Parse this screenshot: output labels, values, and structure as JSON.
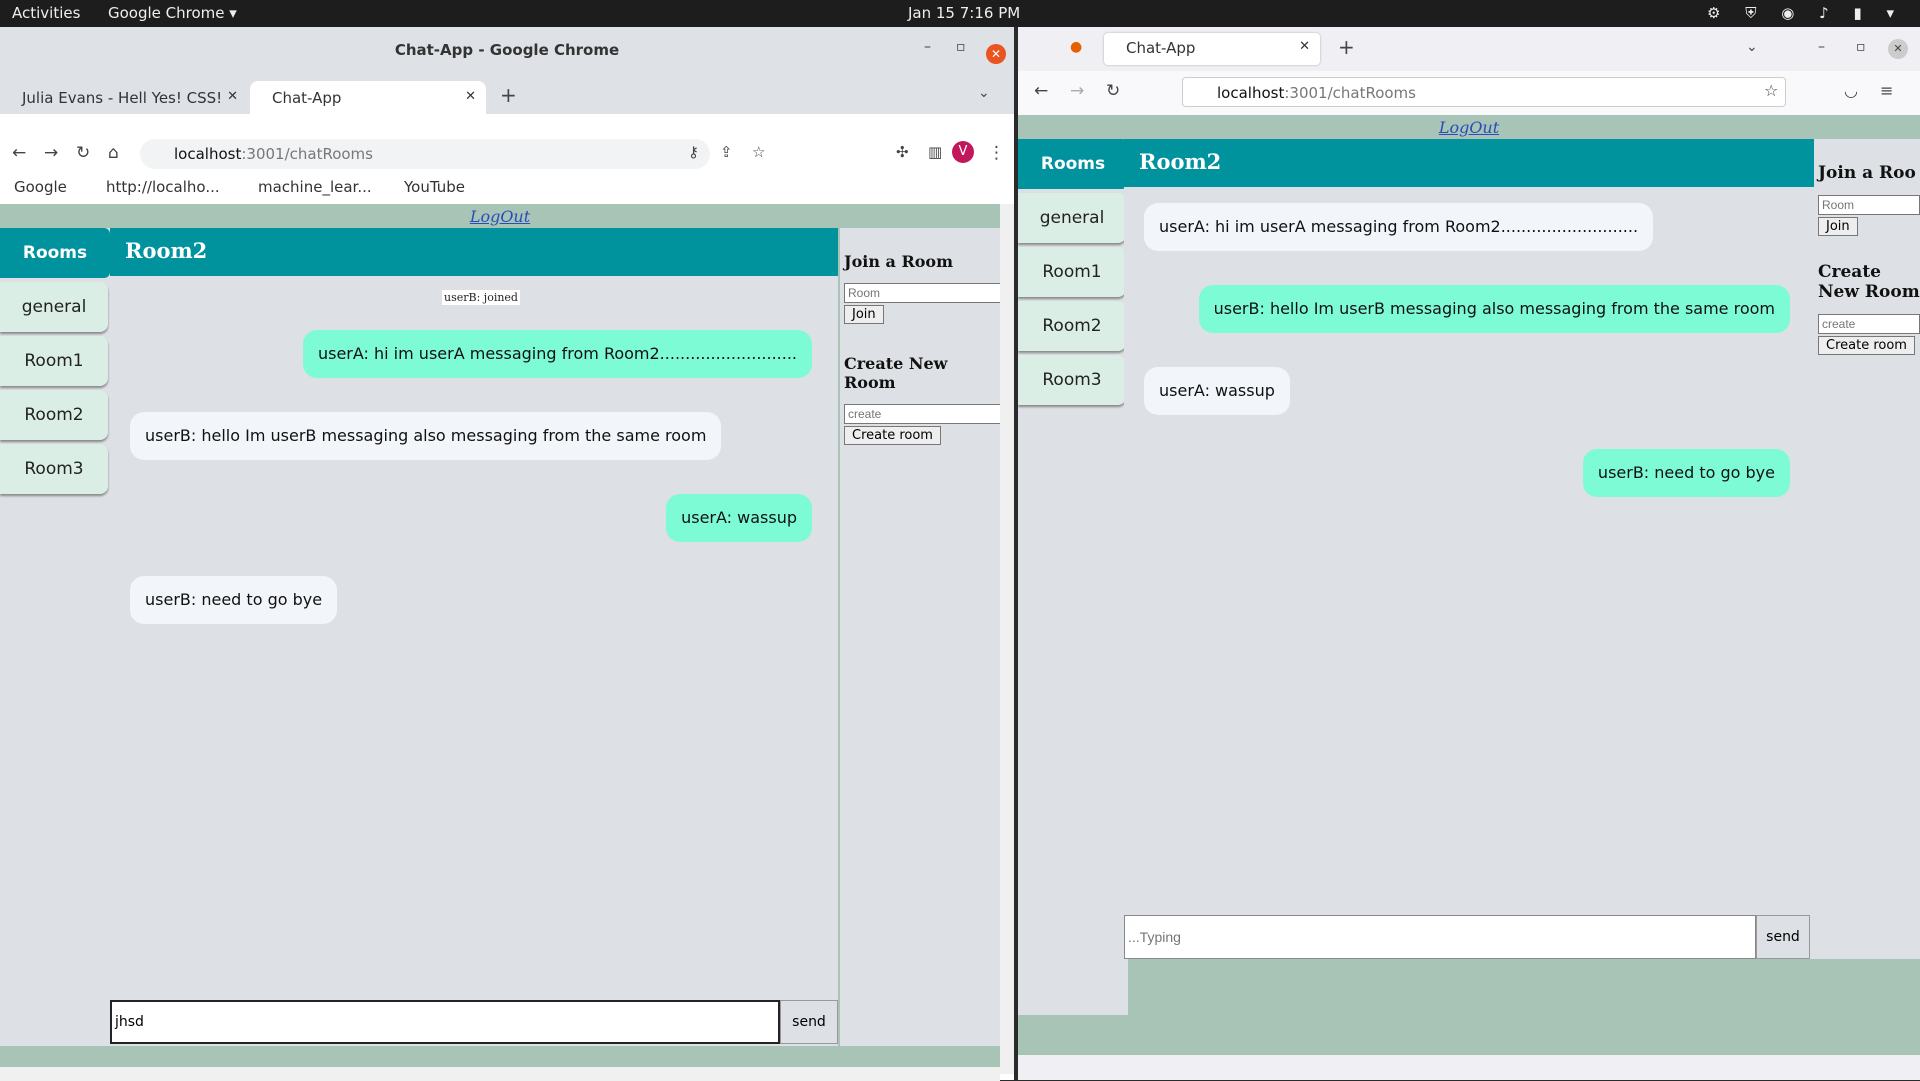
{
  "os": {
    "activities": "Activities",
    "app_menu": "Google Chrome ▾",
    "clock": "Jan 15  7:16 PM",
    "tray": "⚙ ⛨ ◉ ♪ ▮ ▾"
  },
  "chrome": {
    "window_title": "Chat-App - Google Chrome",
    "tabs": [
      {
        "label": "Julia Evans - Hell Yes! CSS!"
      },
      {
        "label": "Chat-App"
      }
    ],
    "url_host": "localhost",
    "url_path": ":3001/chatRooms",
    "bookmarks": [
      "Google",
      "http://localho...",
      "machine_lear...",
      "YouTube"
    ],
    "avatar": "V"
  },
  "firefox": {
    "tab_label": "Chat-App",
    "url_host": "localhost",
    "url_path": ":3001/chatRooms"
  },
  "app_left": {
    "logout": "LogOut",
    "rooms_header": "Rooms",
    "rooms": [
      "general",
      "Room1",
      "Room2",
      "Room3"
    ],
    "room_title": "Room2",
    "joined_notice": "userB: joined",
    "messages": [
      {
        "text": "userA: hi im userA messaging from Room2...........................",
        "side": "out"
      },
      {
        "text": "userB: hello Im userB messaging also messaging from the same room",
        "side": "in"
      },
      {
        "text": "userA: wassup",
        "side": "out"
      },
      {
        "text": "userB: need to go bye",
        "side": "in"
      }
    ],
    "join_heading": "Join a Room",
    "join_placeholder": "Room",
    "join_button": "Join",
    "create_heading": "Create New Room",
    "create_placeholder": "create",
    "create_button": "Create room",
    "composer_value": "jhsd",
    "send_label": "send"
  },
  "app_right": {
    "logout": "LogOut",
    "rooms_header": "Rooms",
    "rooms": [
      "general",
      "Room1",
      "Room2",
      "Room3"
    ],
    "room_title": "Room2",
    "messages": [
      {
        "text": "userA: hi im userA messaging from Room2...........................",
        "side": "in"
      },
      {
        "text": "userB: hello Im userB messaging also messaging from the same room",
        "side": "out"
      },
      {
        "text": "userA: wassup",
        "side": "in"
      },
      {
        "text": "userB: need to go bye",
        "side": "out"
      }
    ],
    "join_heading": "Join a Roo",
    "join_placeholder": "Room",
    "join_button": "Join",
    "create_heading": "Create New Room",
    "create_placeholder": "create",
    "create_button": "Create room",
    "composer_placeholder": "...Typing",
    "send_label": "send"
  }
}
